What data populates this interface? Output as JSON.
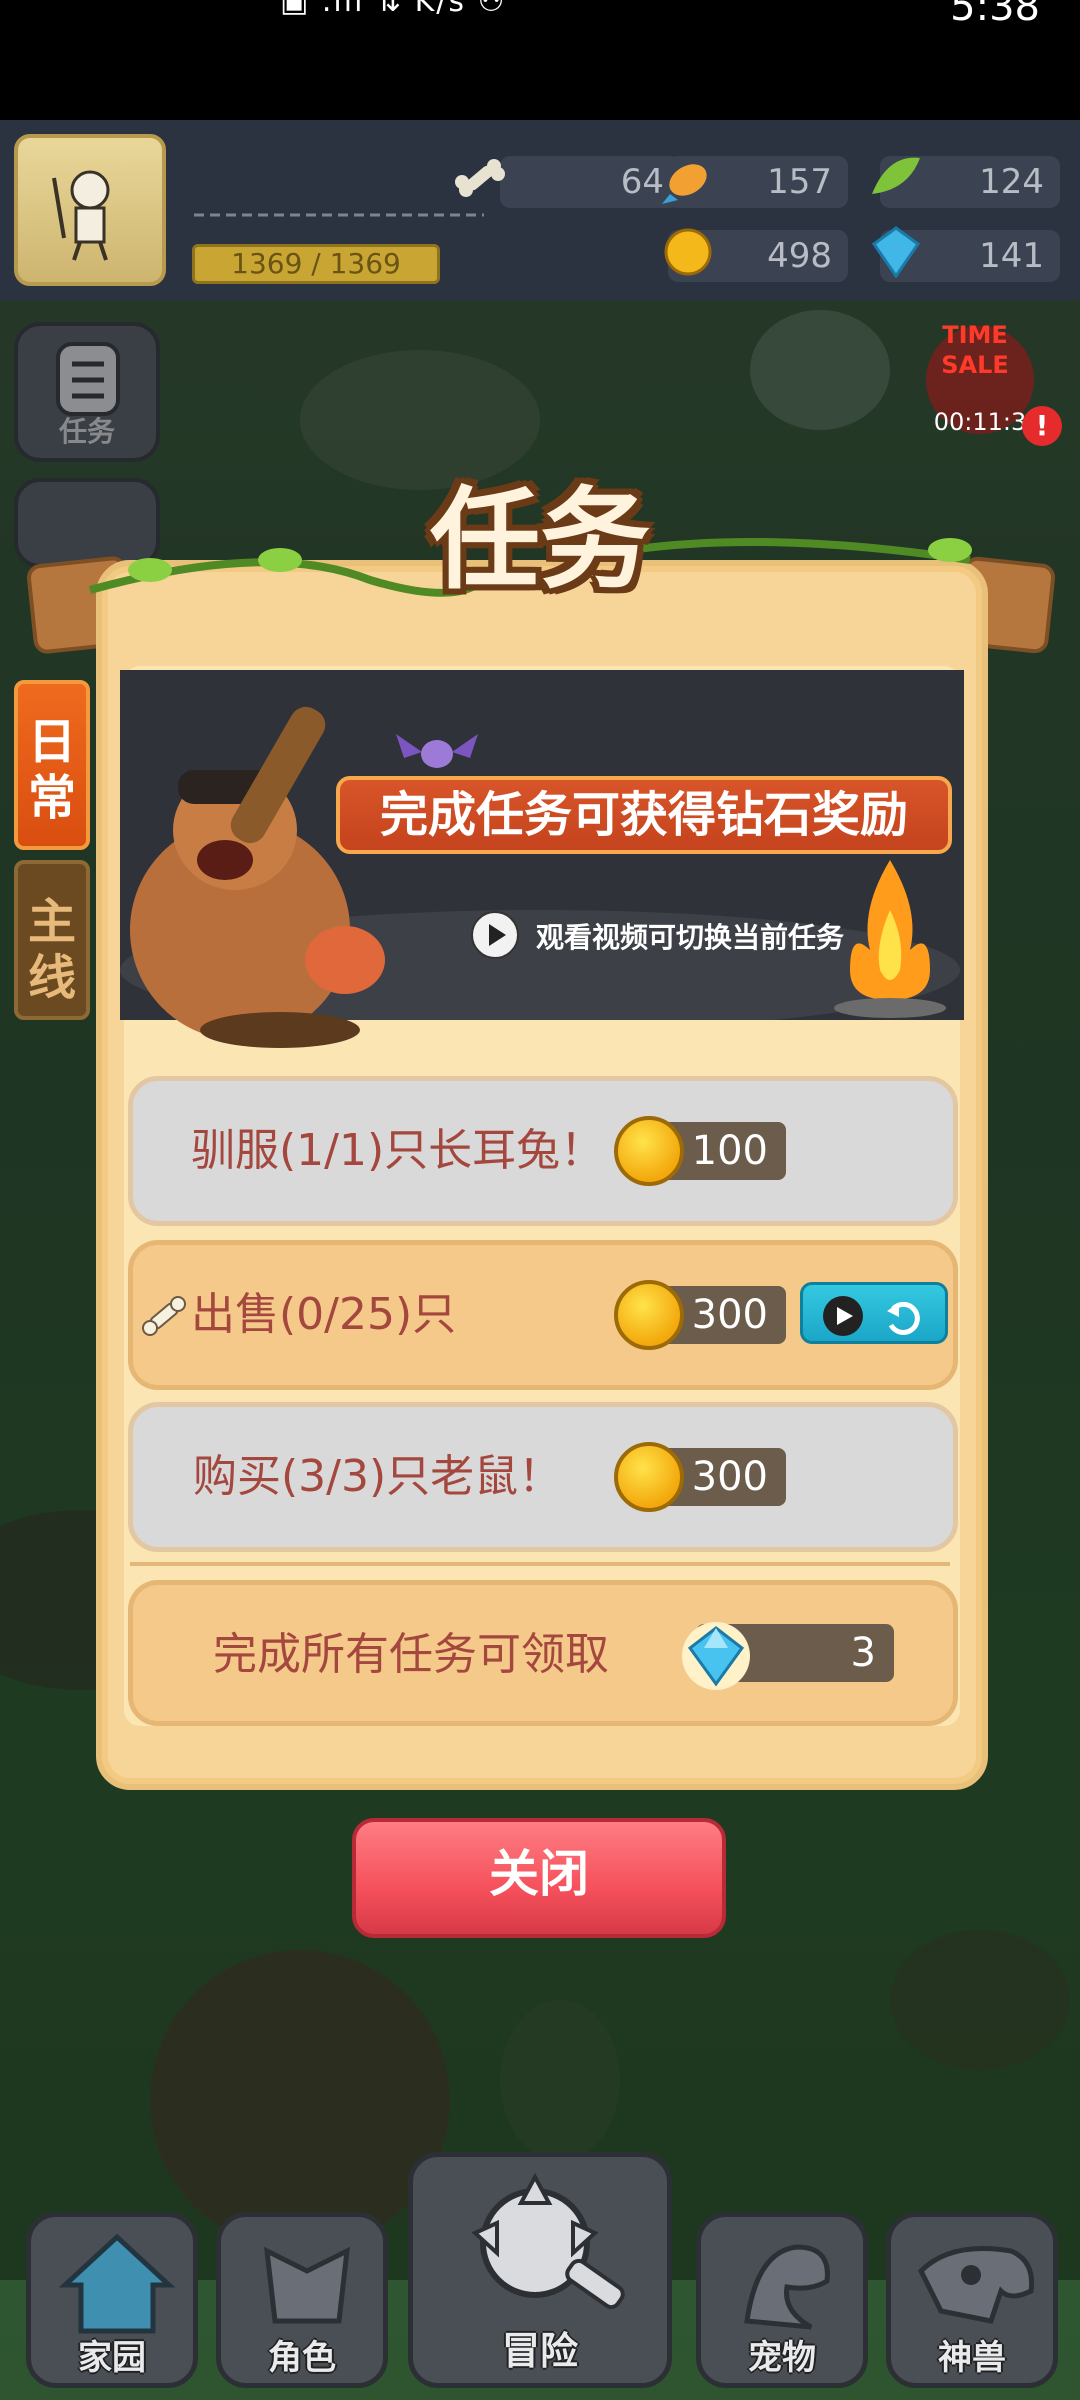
{
  "status_bar": {
    "left": "▣ .ıll ⇅ K/s ⚇",
    "time": "5:38"
  },
  "top_bar": {
    "xp": "1369 / 1369",
    "resources": [
      {
        "icon": "bone-icon",
        "value": "64"
      },
      {
        "icon": "fish-icon",
        "value": "157"
      },
      {
        "icon": "leaf-icon",
        "value": "124"
      },
      {
        "icon": "gold-coin-icon",
        "value": "498"
      },
      {
        "icon": "diamond-icon",
        "value": "141"
      }
    ]
  },
  "side_menu": {
    "task_label": "任务",
    "tab_daily": "日常",
    "tab_main": "主线"
  },
  "time_sale": {
    "label_1": "TIME",
    "label_2": "SALE",
    "timer": "00:11:3"
  },
  "panel": {
    "title": "任务",
    "banner_title": "完成任务可获得钻石奖励",
    "banner_sub": "观看视频可切换当前任务",
    "tasks": [
      {
        "text": "驯服(1/1)只长耳兔！",
        "reward": "100"
      },
      {
        "text": "出售(0/25)只",
        "reward": "300"
      },
      {
        "text": "购买(3/3)只老鼠！",
        "reward": "300"
      }
    ],
    "final": {
      "text": "完成所有任务可领取",
      "reward": "3"
    },
    "close_label": "关闭"
  },
  "bottom_nav": [
    {
      "label": "家园"
    },
    {
      "label": "角色"
    },
    {
      "label": "冒险"
    },
    {
      "label": "宠物"
    },
    {
      "label": "神兽"
    }
  ],
  "colors": {
    "accent_red": "#f5505b",
    "panel": "#f7d598",
    "task_text": "#a4473e",
    "cyan": "#1ba6c7"
  }
}
